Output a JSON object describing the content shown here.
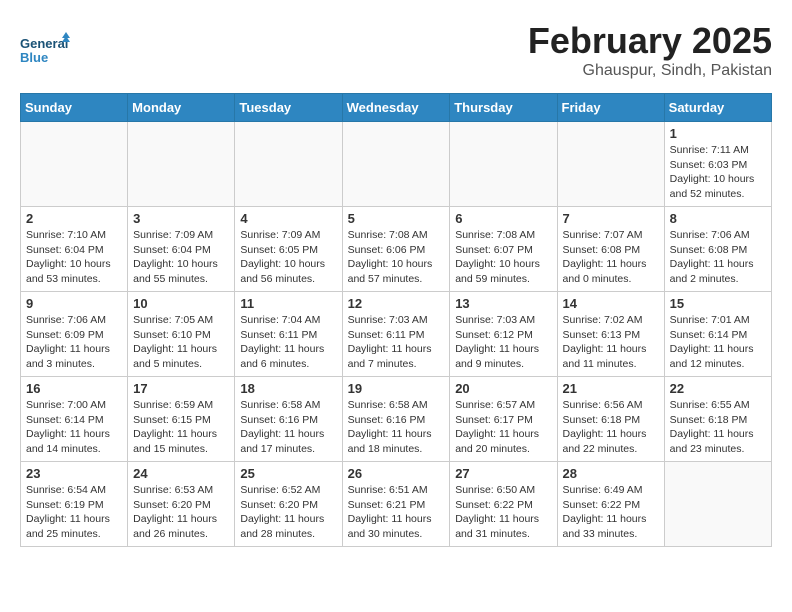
{
  "logo": {
    "line1": "General",
    "line2": "Blue"
  },
  "title": "February 2025",
  "location": "Ghauspur, Sindh, Pakistan",
  "headers": [
    "Sunday",
    "Monday",
    "Tuesday",
    "Wednesday",
    "Thursday",
    "Friday",
    "Saturday"
  ],
  "weeks": [
    [
      {
        "day": "",
        "info": ""
      },
      {
        "day": "",
        "info": ""
      },
      {
        "day": "",
        "info": ""
      },
      {
        "day": "",
        "info": ""
      },
      {
        "day": "",
        "info": ""
      },
      {
        "day": "",
        "info": ""
      },
      {
        "day": "1",
        "info": "Sunrise: 7:11 AM\nSunset: 6:03 PM\nDaylight: 10 hours\nand 52 minutes."
      }
    ],
    [
      {
        "day": "2",
        "info": "Sunrise: 7:10 AM\nSunset: 6:04 PM\nDaylight: 10 hours\nand 53 minutes."
      },
      {
        "day": "3",
        "info": "Sunrise: 7:09 AM\nSunset: 6:04 PM\nDaylight: 10 hours\nand 55 minutes."
      },
      {
        "day": "4",
        "info": "Sunrise: 7:09 AM\nSunset: 6:05 PM\nDaylight: 10 hours\nand 56 minutes."
      },
      {
        "day": "5",
        "info": "Sunrise: 7:08 AM\nSunset: 6:06 PM\nDaylight: 10 hours\nand 57 minutes."
      },
      {
        "day": "6",
        "info": "Sunrise: 7:08 AM\nSunset: 6:07 PM\nDaylight: 10 hours\nand 59 minutes."
      },
      {
        "day": "7",
        "info": "Sunrise: 7:07 AM\nSunset: 6:08 PM\nDaylight: 11 hours\nand 0 minutes."
      },
      {
        "day": "8",
        "info": "Sunrise: 7:06 AM\nSunset: 6:08 PM\nDaylight: 11 hours\nand 2 minutes."
      }
    ],
    [
      {
        "day": "9",
        "info": "Sunrise: 7:06 AM\nSunset: 6:09 PM\nDaylight: 11 hours\nand 3 minutes."
      },
      {
        "day": "10",
        "info": "Sunrise: 7:05 AM\nSunset: 6:10 PM\nDaylight: 11 hours\nand 5 minutes."
      },
      {
        "day": "11",
        "info": "Sunrise: 7:04 AM\nSunset: 6:11 PM\nDaylight: 11 hours\nand 6 minutes."
      },
      {
        "day": "12",
        "info": "Sunrise: 7:03 AM\nSunset: 6:11 PM\nDaylight: 11 hours\nand 7 minutes."
      },
      {
        "day": "13",
        "info": "Sunrise: 7:03 AM\nSunset: 6:12 PM\nDaylight: 11 hours\nand 9 minutes."
      },
      {
        "day": "14",
        "info": "Sunrise: 7:02 AM\nSunset: 6:13 PM\nDaylight: 11 hours\nand 11 minutes."
      },
      {
        "day": "15",
        "info": "Sunrise: 7:01 AM\nSunset: 6:14 PM\nDaylight: 11 hours\nand 12 minutes."
      }
    ],
    [
      {
        "day": "16",
        "info": "Sunrise: 7:00 AM\nSunset: 6:14 PM\nDaylight: 11 hours\nand 14 minutes."
      },
      {
        "day": "17",
        "info": "Sunrise: 6:59 AM\nSunset: 6:15 PM\nDaylight: 11 hours\nand 15 minutes."
      },
      {
        "day": "18",
        "info": "Sunrise: 6:58 AM\nSunset: 6:16 PM\nDaylight: 11 hours\nand 17 minutes."
      },
      {
        "day": "19",
        "info": "Sunrise: 6:58 AM\nSunset: 6:16 PM\nDaylight: 11 hours\nand 18 minutes."
      },
      {
        "day": "20",
        "info": "Sunrise: 6:57 AM\nSunset: 6:17 PM\nDaylight: 11 hours\nand 20 minutes."
      },
      {
        "day": "21",
        "info": "Sunrise: 6:56 AM\nSunset: 6:18 PM\nDaylight: 11 hours\nand 22 minutes."
      },
      {
        "day": "22",
        "info": "Sunrise: 6:55 AM\nSunset: 6:18 PM\nDaylight: 11 hours\nand 23 minutes."
      }
    ],
    [
      {
        "day": "23",
        "info": "Sunrise: 6:54 AM\nSunset: 6:19 PM\nDaylight: 11 hours\nand 25 minutes."
      },
      {
        "day": "24",
        "info": "Sunrise: 6:53 AM\nSunset: 6:20 PM\nDaylight: 11 hours\nand 26 minutes."
      },
      {
        "day": "25",
        "info": "Sunrise: 6:52 AM\nSunset: 6:20 PM\nDaylight: 11 hours\nand 28 minutes."
      },
      {
        "day": "26",
        "info": "Sunrise: 6:51 AM\nSunset: 6:21 PM\nDaylight: 11 hours\nand 30 minutes."
      },
      {
        "day": "27",
        "info": "Sunrise: 6:50 AM\nSunset: 6:22 PM\nDaylight: 11 hours\nand 31 minutes."
      },
      {
        "day": "28",
        "info": "Sunrise: 6:49 AM\nSunset: 6:22 PM\nDaylight: 11 hours\nand 33 minutes."
      },
      {
        "day": "",
        "info": ""
      }
    ]
  ]
}
